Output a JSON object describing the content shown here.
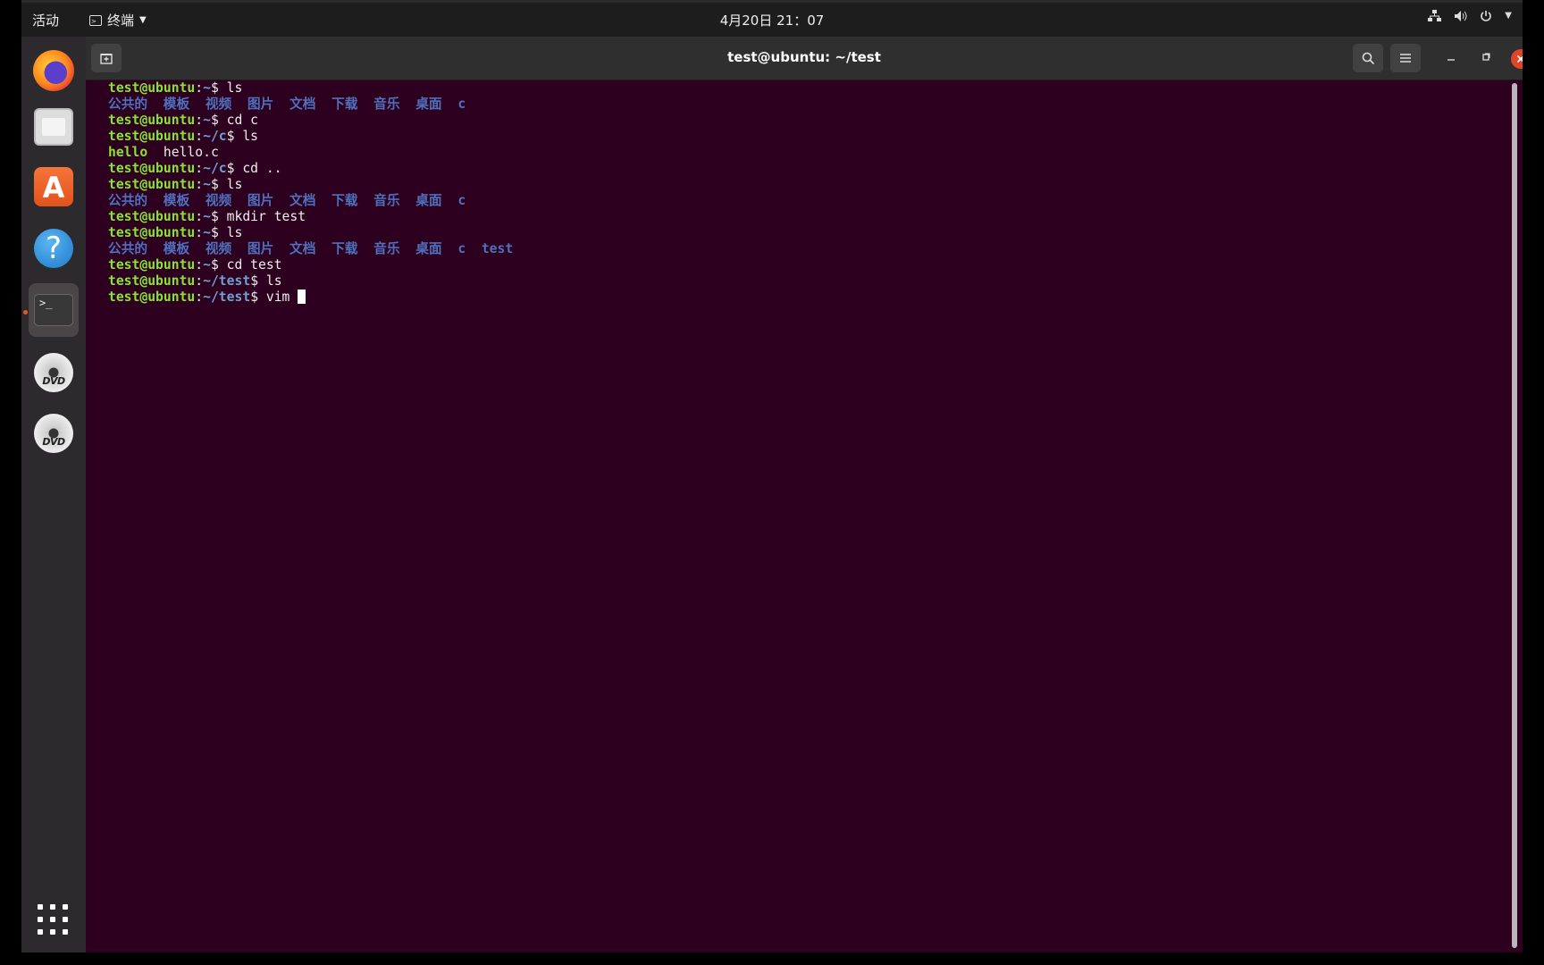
{
  "topbar": {
    "activities": "活动",
    "app_menu_label": "终端",
    "clock": "4月20日  21：07",
    "tray_icons": [
      "network-icon",
      "volume-icon",
      "power-icon",
      "chevron-down-icon"
    ]
  },
  "dock": {
    "apps": [
      "firefox",
      "files",
      "software",
      "help",
      "terminal",
      "dvd",
      "dvd"
    ],
    "dvd_label": "DVD",
    "help_glyph": "?",
    "store_glyph": "A",
    "term_glyph": ">_"
  },
  "window": {
    "title": "test@ubuntu: ~/test"
  },
  "terminal": {
    "user": "test@ubuntu",
    "lines": [
      {
        "kind": "prompt",
        "path": "~",
        "cmd": " ls"
      },
      {
        "kind": "ls",
        "items": [
          "公共的",
          "模板",
          "视频",
          "图片",
          "文档",
          "下载",
          "音乐",
          "桌面",
          "c"
        ]
      },
      {
        "kind": "prompt",
        "path": "~",
        "cmd": " cd c"
      },
      {
        "kind": "prompt",
        "path": "~/c",
        "cmd": " ls"
      },
      {
        "kind": "files",
        "items": [
          {
            "name": "hello",
            "exec": true
          },
          {
            "name": "hello.c",
            "exec": false
          }
        ]
      },
      {
        "kind": "prompt",
        "path": "~/c",
        "cmd": " cd .."
      },
      {
        "kind": "prompt",
        "path": "~",
        "cmd": " ls"
      },
      {
        "kind": "ls",
        "items": [
          "公共的",
          "模板",
          "视频",
          "图片",
          "文档",
          "下载",
          "音乐",
          "桌面",
          "c"
        ]
      },
      {
        "kind": "prompt",
        "path": "~",
        "cmd": " mkdir test"
      },
      {
        "kind": "prompt",
        "path": "~",
        "cmd": " ls"
      },
      {
        "kind": "ls",
        "items": [
          "公共的",
          "模板",
          "视频",
          "图片",
          "文档",
          "下载",
          "音乐",
          "桌面",
          "c",
          "test"
        ]
      },
      {
        "kind": "prompt",
        "path": "~",
        "cmd": " cd test"
      },
      {
        "kind": "prompt",
        "path": "~/test",
        "cmd": " ls"
      },
      {
        "kind": "prompt",
        "path": "~/test",
        "cmd": " vim ",
        "cursor": true
      }
    ]
  },
  "colors": {
    "terminal_bg": "#2c001e",
    "prompt_user": "#8ae234",
    "prompt_path": "#729fcf",
    "directory": "#5070bd",
    "close_button": "#e0452a"
  }
}
